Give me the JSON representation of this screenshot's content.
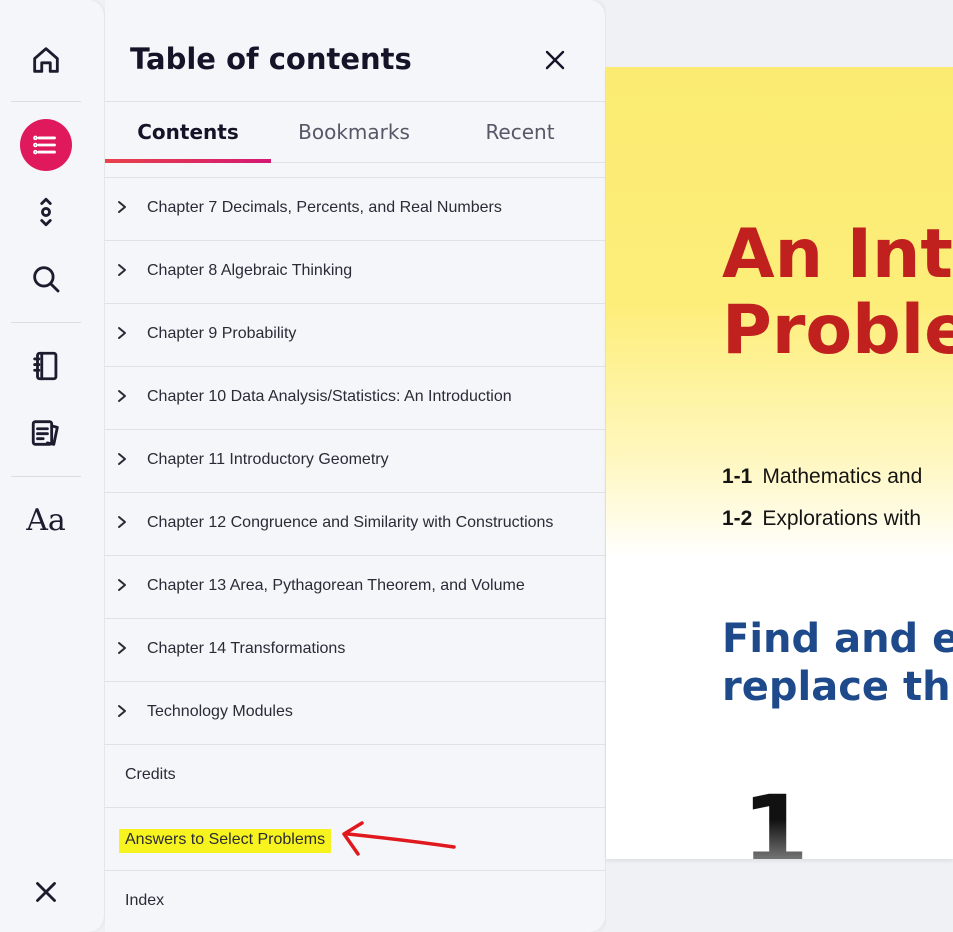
{
  "rail": {
    "items": [
      {
        "icon": "home-icon"
      },
      {
        "icon": "list-icon",
        "active": true
      },
      {
        "icon": "expand-icon"
      },
      {
        "icon": "search-icon"
      },
      {
        "icon": "notebook-icon"
      },
      {
        "icon": "flashcard-icon"
      },
      {
        "icon": "font-size-icon",
        "glyph": "Aa"
      }
    ],
    "close_icon": "close-icon"
  },
  "toc": {
    "title": "Table of contents",
    "tabs": [
      "Contents",
      "Bookmarks",
      "Recent"
    ],
    "active_tab": "Contents",
    "items": [
      {
        "label": "Chapter 7 Decimals, Percents, and Real Numbers",
        "expandable": true
      },
      {
        "label": "Chapter 8 Algebraic Thinking",
        "expandable": true
      },
      {
        "label": "Chapter 9 Probability",
        "expandable": true
      },
      {
        "label": "Chapter 10 Data Analysis/Statistics: An Introduction",
        "expandable": true
      },
      {
        "label": "Chapter 11 Introductory Geometry",
        "expandable": true
      },
      {
        "label": "Chapter 12 Congruence and Similarity with Constructions",
        "expandable": true
      },
      {
        "label": "Chapter 13 Area, Pythagorean Theorem, and Volume",
        "expandable": true
      },
      {
        "label": "Chapter 14 Transformations",
        "expandable": true
      },
      {
        "label": "Technology Modules",
        "expandable": true
      },
      {
        "label": "Credits",
        "expandable": false
      },
      {
        "label": "Answers to Select Problems",
        "expandable": false,
        "highlighted": true
      },
      {
        "label": "Index",
        "expandable": false
      }
    ]
  },
  "page": {
    "title": "An Intr\nProble",
    "sections": [
      {
        "num": "1-1",
        "text": "Mathematics and"
      },
      {
        "num": "1-2",
        "text": "Explorations with"
      }
    ],
    "heading": "Find and e\nreplace th",
    "digit": "1"
  },
  "colors": {
    "accent": "#e0195c",
    "highlight": "#f7f31e",
    "annotation_arrow": "#e0191f",
    "page_title": "#c0211e",
    "page_heading": "#1e4a8c"
  }
}
